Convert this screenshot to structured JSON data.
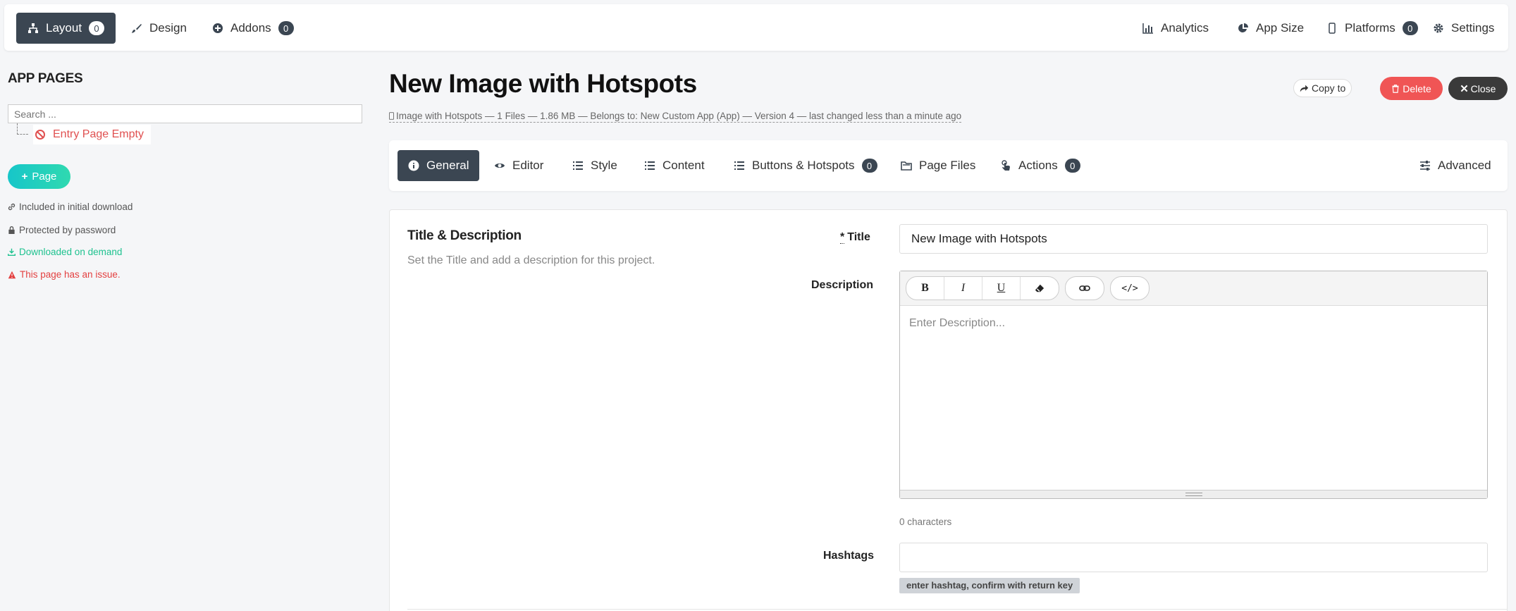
{
  "topnav": {
    "left": [
      {
        "label": "Layout",
        "badge": "0",
        "icon": "sitemap-icon"
      },
      {
        "label": "Design",
        "icon": "brush-icon"
      },
      {
        "label": "Addons",
        "badge": "0",
        "icon": "plus-circle-icon"
      }
    ],
    "right": [
      {
        "label": "Analytics",
        "icon": "bar-chart-icon"
      },
      {
        "label": "App Size",
        "icon": "pie-chart-icon"
      },
      {
        "label": "Platforms",
        "badge": "0",
        "icon": "mobile-icon"
      },
      {
        "label": "Settings",
        "icon": "gear-icon"
      }
    ]
  },
  "sidebar": {
    "title": "APP PAGES",
    "search_placeholder": "Search ...",
    "tree_item": "Entry Page Empty",
    "add_page_label": "Page",
    "legend": [
      {
        "text": "Included in initial download",
        "icon": "link-icon",
        "color": "#555555"
      },
      {
        "text": "Protected by password",
        "icon": "lock-icon",
        "color": "#555555"
      },
      {
        "text": "Downloaded on demand",
        "icon": "download-icon",
        "color": "#1ec28f"
      },
      {
        "text": "This page has an issue.",
        "icon": "warning-icon",
        "color": "#e34040"
      }
    ]
  },
  "header": {
    "title": "New Image with Hotspots",
    "meta": "Image with Hotspots — 1 Files — 1.86 MB — Belongs to: New Custom App (App) — Version 4 — last changed less than a minute ago",
    "copy_label": "Copy to",
    "delete_label": "Delete",
    "close_label": "Close"
  },
  "tabs": [
    {
      "label": "General",
      "icon": "info-icon"
    },
    {
      "label": "Editor",
      "icon": "eye-icon"
    },
    {
      "label": "Style",
      "icon": "list-icon"
    },
    {
      "label": "Content",
      "icon": "list-icon"
    },
    {
      "label": "Buttons & Hotspots",
      "badge": "0",
      "icon": "list-icon"
    },
    {
      "label": "Page Files",
      "icon": "folder-icon"
    },
    {
      "label": "Actions",
      "badge": "0",
      "icon": "touch-icon"
    },
    {
      "label": "Advanced",
      "icon": "sliders-icon"
    }
  ],
  "form": {
    "section_title": "Title & Description",
    "section_desc": "Set the Title and add a description for this project.",
    "required_mark": "*",
    "title_label": "Title",
    "title_value": "New Image with Hotspots",
    "description_label": "Description",
    "toolbar": {
      "bold": "B",
      "italic": "I",
      "underline": "U",
      "eraser": "eraser-icon",
      "link": "link-icon",
      "code": "</>"
    },
    "description_placeholder": "Enter Description...",
    "char_count": "0 characters",
    "hashtags_label": "Hashtags",
    "hashtag_hint": "enter hashtag, confirm with return key"
  }
}
